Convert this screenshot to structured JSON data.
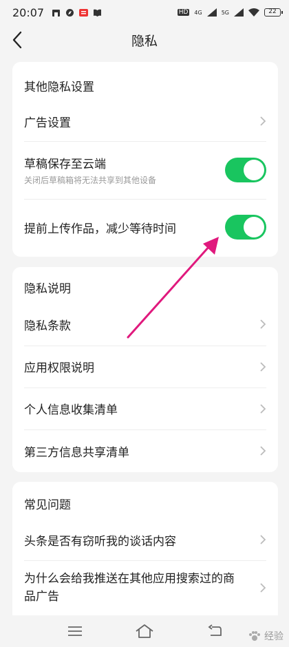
{
  "status_bar": {
    "time": "20:07",
    "network_1": "4G",
    "network_2": "5G",
    "battery": "22",
    "hd_label": "HD"
  },
  "nav": {
    "title": "隐私"
  },
  "section_other": {
    "title": "其他隐私设置",
    "items": [
      {
        "label": "广告设置",
        "type": "link"
      },
      {
        "label": "草稿保存至云端",
        "sub": "关闭后草稿箱将无法共享到其他设备",
        "type": "toggle",
        "on": true
      },
      {
        "label": "提前上传作品，减少等待时间",
        "type": "toggle",
        "on": true
      }
    ]
  },
  "section_privacy": {
    "title": "隐私说明",
    "items": [
      {
        "label": "隐私条款"
      },
      {
        "label": "应用权限说明"
      },
      {
        "label": "个人信息收集清单"
      },
      {
        "label": "第三方信息共享清单"
      }
    ]
  },
  "section_faq": {
    "title": "常见问题",
    "items": [
      {
        "label": "头条是否有窃听我的谈话内容"
      },
      {
        "label": "为什么会给我推送在其他应用搜索过的商品广告"
      }
    ]
  },
  "watermark": "经验",
  "colors": {
    "toggle_on": "#19c55f",
    "annotation_arrow": "#e0197d",
    "background": "#f4f4f4"
  }
}
